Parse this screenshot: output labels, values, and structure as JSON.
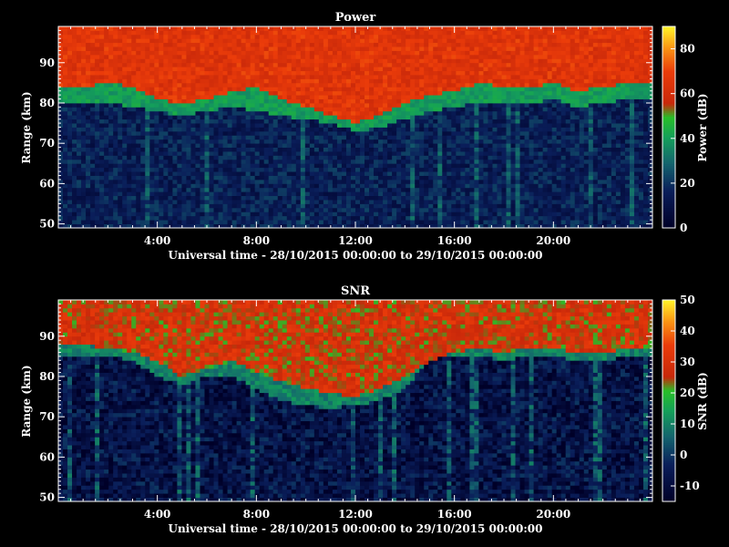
{
  "chart_data": [
    {
      "type": "heatmap",
      "title": "Power",
      "xlabel": "Universal time - 28/10/2015 00:00:00 to 29/10/2015 00:00:00",
      "ylabel": "Range (km)",
      "x_tick_labels": [
        "4:00",
        "8:00",
        "12:00",
        "16:00",
        "20:00"
      ],
      "x_tick_values_hours": [
        4,
        8,
        12,
        16,
        20
      ],
      "xlim_hours": [
        0,
        24
      ],
      "y_tick_values": [
        50,
        60,
        70,
        80,
        90
      ],
      "ylim": [
        49,
        99
      ],
      "colorbar": {
        "label": "Power (dB)",
        "ticks": [
          0,
          20,
          40,
          60,
          80
        ],
        "range": [
          0,
          90
        ]
      },
      "description_layers": {
        "red_top_boundary_km": [
          84,
          84,
          85,
          84,
          81,
          80,
          81,
          83,
          84,
          81,
          79,
          77,
          75,
          77,
          80,
          82,
          83,
          85,
          84,
          84,
          85,
          83,
          84,
          85,
          85
        ],
        "green_band_bottom_km": [
          80,
          80,
          80,
          79,
          78,
          77,
          78,
          79,
          78,
          77,
          76,
          75,
          73,
          74,
          76,
          78,
          79,
          80,
          80,
          80,
          81,
          79,
          80,
          81,
          81
        ],
        "upper_value_db": 65,
        "band_value_db": 40,
        "lower_value_db": 15
      }
    },
    {
      "type": "heatmap",
      "title": "SNR",
      "xlabel": "Universal time - 28/10/2015 00:00:00 to 29/10/2015 00:00:00",
      "ylabel": "Range (km)",
      "x_tick_labels": [
        "4:00",
        "8:00",
        "12:00",
        "16:00",
        "20:00"
      ],
      "x_tick_values_hours": [
        4,
        8,
        12,
        16,
        20
      ],
      "xlim_hours": [
        0,
        24
      ],
      "y_tick_values": [
        50,
        60,
        70,
        80,
        90
      ],
      "ylim": [
        49,
        99
      ],
      "colorbar": {
        "label": "SNR (dB)",
        "ticks": [
          -10,
          0,
          10,
          20,
          30,
          40,
          50
        ],
        "range": [
          -15,
          50
        ]
      },
      "description_layers": {
        "red_top_boundary_km": [
          88,
          88,
          87,
          86,
          84,
          80,
          82,
          84,
          81,
          79,
          77,
          76,
          75,
          77,
          80,
          84,
          86,
          87,
          86,
          87,
          87,
          86,
          86,
          87,
          87
        ],
        "green_band_bottom_km": [
          85,
          85,
          85,
          84,
          80,
          78,
          80,
          80,
          77,
          74,
          73,
          72,
          73,
          74,
          77,
          85,
          85,
          85,
          84,
          85,
          85,
          84,
          84,
          85,
          85
        ],
        "upper_value_db": 28,
        "band_value_db": 10,
        "lower_value_db": -8
      }
    }
  ]
}
